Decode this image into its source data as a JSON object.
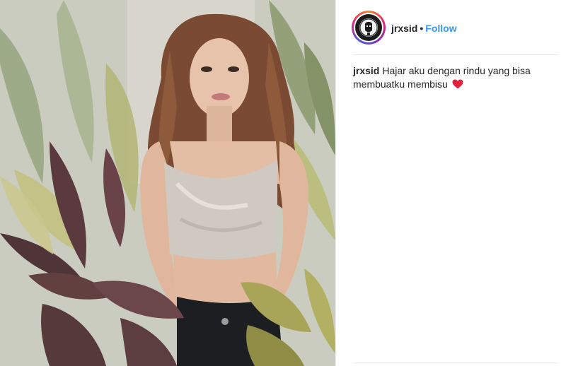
{
  "post": {
    "username": "jrxsid",
    "separator": "•",
    "follow_label": "Follow",
    "caption": {
      "username": "jrxsid",
      "text": "Hajar aku dengan rindu yang bisa membuatku membisu",
      "emoji": "heart-emoji"
    }
  },
  "colors": {
    "follow": "#3897f0",
    "heart": "#e0223f",
    "avatar_ring": "#dd2a7b"
  }
}
